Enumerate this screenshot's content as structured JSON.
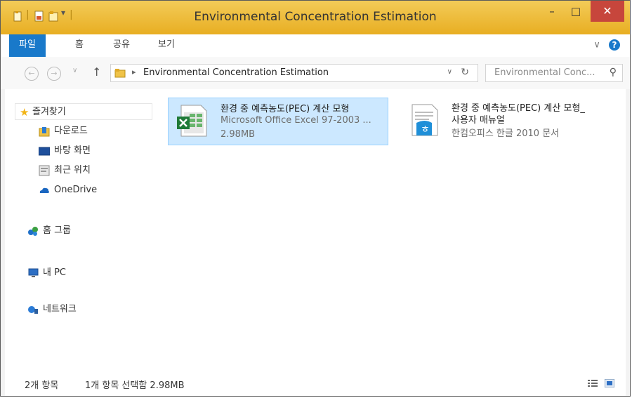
{
  "window": {
    "title": "Environmental Concentration Estimation",
    "minimize_label": "–",
    "maximize_label": "□",
    "close_label": "✕"
  },
  "ribbon": {
    "tabs": [
      {
        "label": "파일"
      },
      {
        "label": "홈"
      },
      {
        "label": "공유"
      },
      {
        "label": "보기"
      }
    ],
    "expand_label": "∨",
    "help_label": "?"
  },
  "navigation": {
    "back_label": "←",
    "forward_label": "→",
    "recent_label": "∨",
    "up_label": "↑",
    "breadcrumb_sep": "▸",
    "path": "Environmental Concentration Estimation",
    "dropdown_label": "∨",
    "refresh_label": "↻",
    "search_placeholder": "Environmental Conc...",
    "search_icon": "⚲"
  },
  "sidebar": {
    "favorites": "즐겨찾기",
    "items": [
      {
        "label": "다운로드",
        "icon": "downloads-folder-icon"
      },
      {
        "label": "바탕 화면",
        "icon": "desktop-icon"
      },
      {
        "label": "최근 위치",
        "icon": "recent-places-icon"
      },
      {
        "label": "OneDrive",
        "icon": "onedrive-icon"
      }
    ],
    "homegroup": "홈 그룹",
    "this_pc": "내 PC",
    "network": "네트워크"
  },
  "files": [
    {
      "name": "환경 중 예측농도(PEC) 계산 모형",
      "type": "Microsoft Office Excel 97-2003 ...",
      "size": "2.98MB",
      "selected": true,
      "icon": "excel-file-icon"
    },
    {
      "name": "환경 중 예측농도(PEC) 계산 모형_",
      "name_line2": "사용자 매뉴얼",
      "type": "한컴오피스 한글 2010 문서",
      "selected": false,
      "icon": "hwp-file-icon"
    }
  ],
  "status": {
    "count": "2개 항목",
    "selection": "1개 항목 선택함 2.98MB"
  },
  "colors": {
    "titlebar": "#e8ae22",
    "accent": "#1979ca",
    "close": "#c7463c",
    "selection": "#cce8ff"
  }
}
